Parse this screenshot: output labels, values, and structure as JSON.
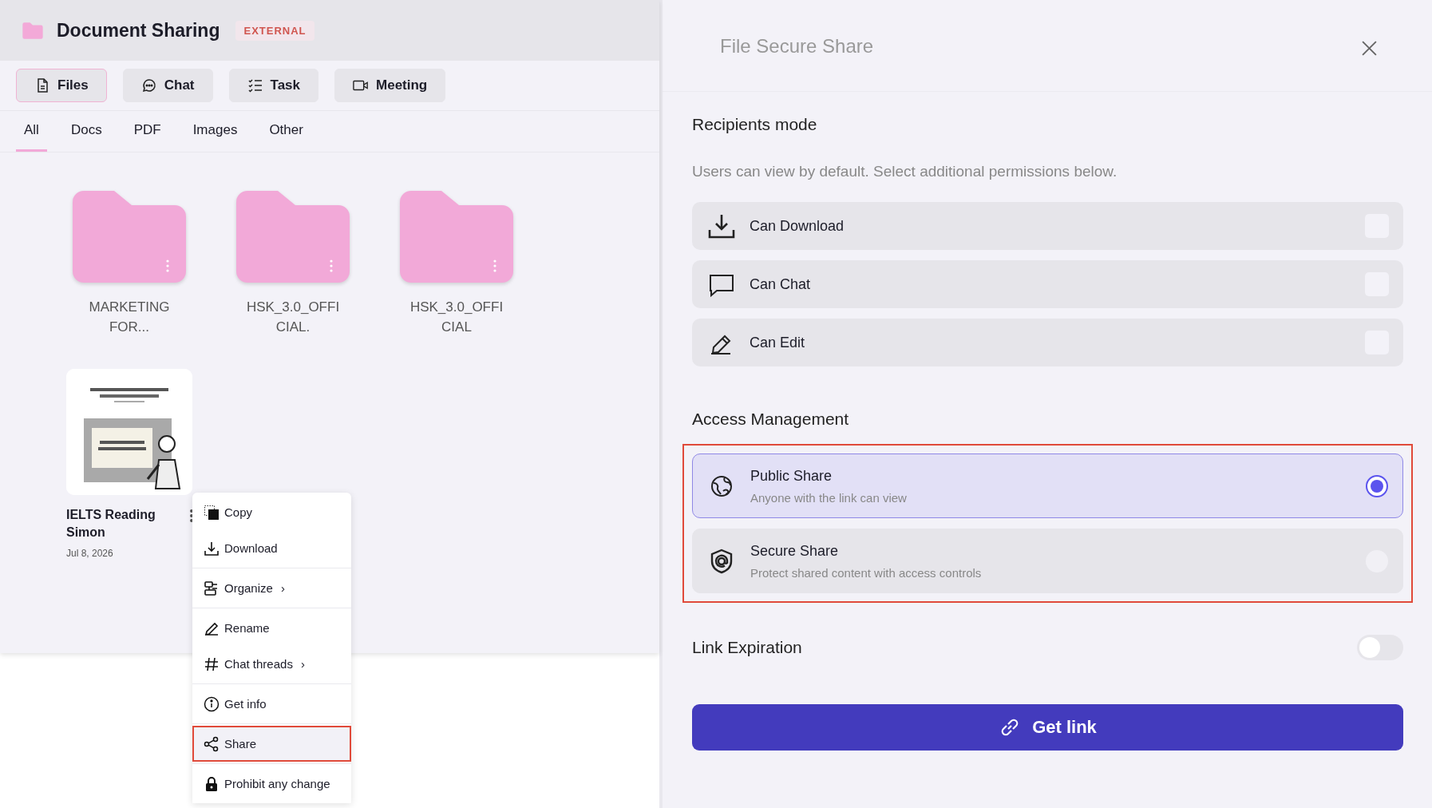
{
  "header": {
    "title": "Document Sharing",
    "badge": "EXTERNAL"
  },
  "tabs": [
    {
      "label": "Files",
      "kind": "files",
      "selected": true
    },
    {
      "label": "Chat",
      "kind": "chat",
      "selected": false
    },
    {
      "label": "Task",
      "kind": "task",
      "selected": false
    },
    {
      "label": "Meeting",
      "kind": "meeting",
      "selected": false
    }
  ],
  "filters": [
    {
      "label": "All",
      "selected": true
    },
    {
      "label": "Docs",
      "selected": false
    },
    {
      "label": "PDF",
      "selected": false
    },
    {
      "label": "Images",
      "selected": false
    },
    {
      "label": "Other",
      "selected": false
    }
  ],
  "folders": [
    {
      "name": "MARKETING FOR..."
    },
    {
      "name": "HSK_3.0_OFFI CIAL."
    },
    {
      "name": "HSK_3.0_OFFI CIAL"
    }
  ],
  "files": [
    {
      "kind": "picture",
      "name": "IELTS Reading Simon",
      "date": "Jul 8, 2026"
    }
  ],
  "context_menu": {
    "groups": [
      [
        {
          "label": "Copy",
          "kind": "copy",
          "highlighted": false
        },
        {
          "label": "Download",
          "kind": "download",
          "highlighted": false
        }
      ],
      [
        {
          "label": "Organize",
          "arrow": "›",
          "kind": "organize",
          "highlighted": false
        }
      ],
      [
        {
          "label": "Rename",
          "kind": "rename",
          "highlighted": false
        },
        {
          "label": "Chat threads",
          "arrow": "›",
          "kind": "threads",
          "highlighted": false
        }
      ],
      [
        {
          "label": "Get info",
          "kind": "info",
          "highlighted": false
        }
      ],
      [
        {
          "label": "Share",
          "kind": "share",
          "highlighted": true
        }
      ],
      [
        {
          "label": "Prohibit any change",
          "kind": "lock",
          "highlighted": false
        }
      ]
    ]
  },
  "share_panel": {
    "title": "File Secure Share",
    "recipients": {
      "heading": "Recipients mode",
      "description": "Users can view by default. Select additional permissions below.",
      "permissions": [
        {
          "label": "Can Download",
          "kind": "download",
          "checked": false
        },
        {
          "label": "Can Chat",
          "kind": "chat",
          "checked": false
        },
        {
          "label": "Can Edit",
          "kind": "edit",
          "checked": false
        }
      ]
    },
    "access": {
      "heading": "Access Management",
      "highlighted": true,
      "options": [
        {
          "title": "Public Share",
          "subtitle": "Anyone with the link can view",
          "kind": "public",
          "selected": true
        },
        {
          "title": "Secure Share",
          "subtitle": "Protect shared content with access controls",
          "kind": "secure",
          "selected": false
        }
      ]
    },
    "link_expiration": {
      "label": "Link Expiration",
      "on": false
    },
    "button": "Get link"
  }
}
